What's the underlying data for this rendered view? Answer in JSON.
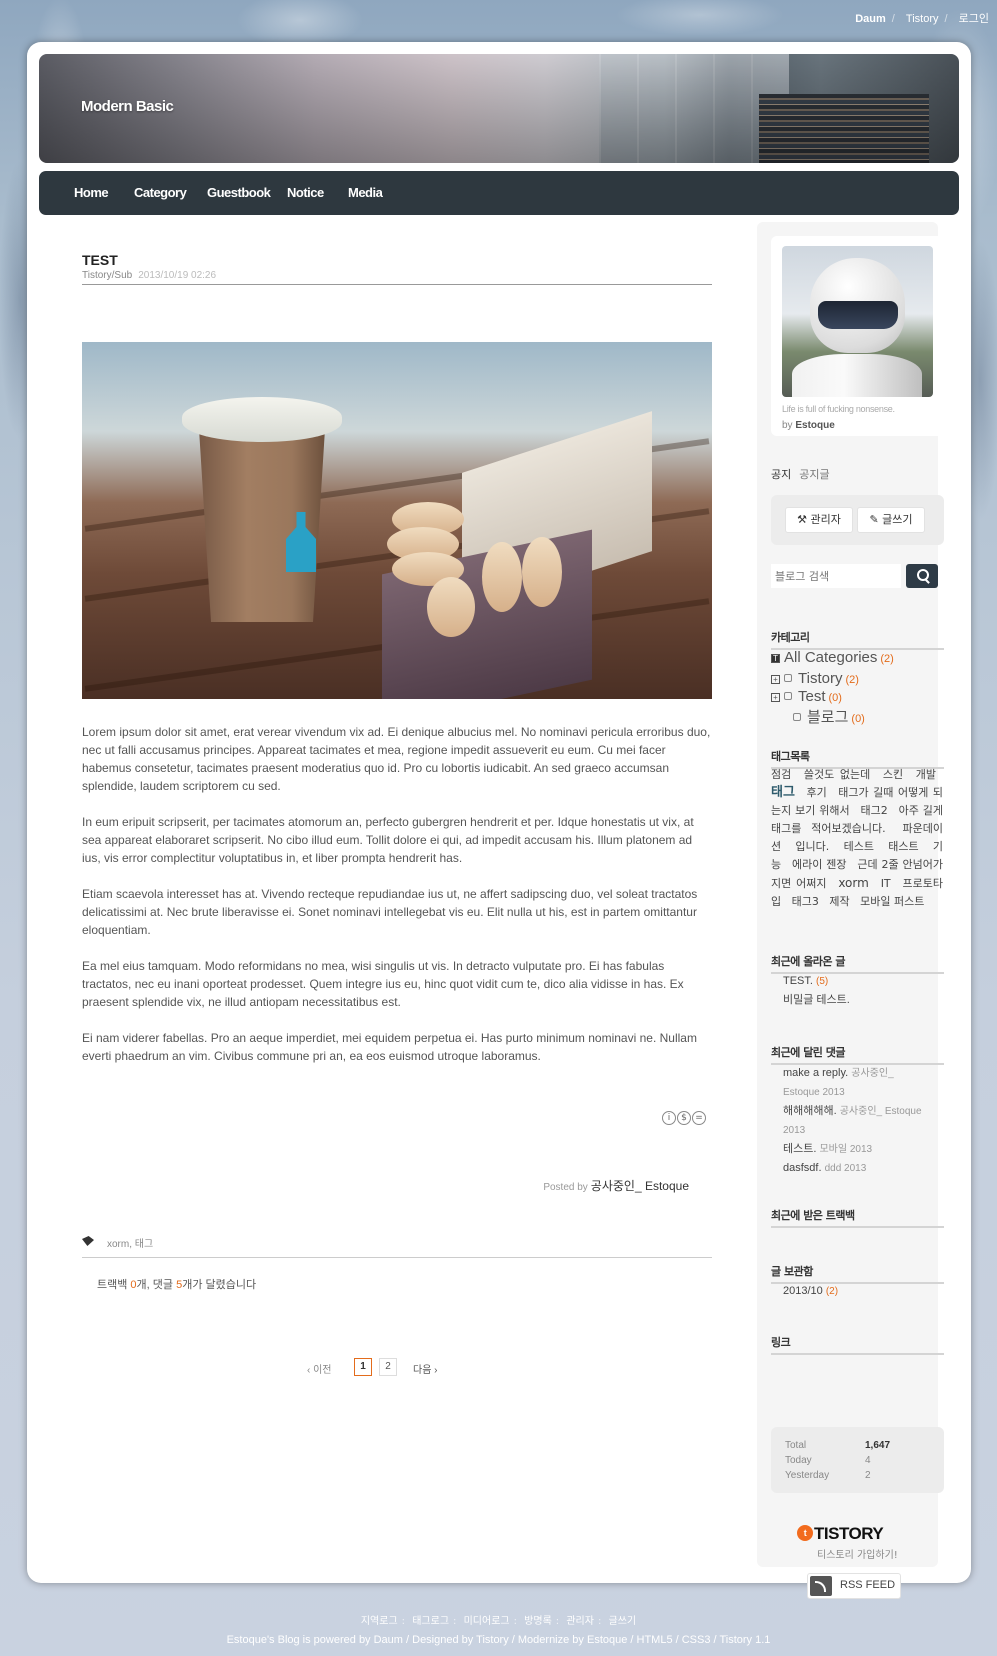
{
  "topnav": {
    "daum": "Daum",
    "tistory": "Tistory",
    "login": "로그인"
  },
  "blog": {
    "title": "Modern Basic"
  },
  "menu": [
    "Home",
    "Category",
    "Guestbook",
    "Notice",
    "Media"
  ],
  "post": {
    "title": "TEST",
    "category": "Tistory/Sub",
    "date": "2013/10/19 02:26",
    "paragraphs": [
      "Lorem ipsum dolor sit amet, erat verear vivendum vix ad. Ei denique albucius mel. No nominavi pericula erroribus duo, nec ut falli accusamus principes. Appareat tacimates et mea, regione impedit assueverit eu eum. Cu mei facer habemus consetetur, tacimates praesent moderatius quo id. Pro cu lobortis iudicabit. An sed graeco accumsan splendide, laudem scriptorem cu sed.",
      "In eum eripuit scripserit, per tacimates atomorum an, perfecto gubergren hendrerit et per. Idque honestatis ut vix, at sea appareat elaboraret scripserit. No cibo illud eum. Tollit dolore ei qui, ad impedit accusam his. Illum platonem ad ius, vis error complectitur voluptatibus in, et liber prompta hendrerit has.",
      "Etiam scaevola interesset has at. Vivendo recteque repudiandae ius ut, ne affert sadipscing duo, vel soleat tractatos delicatissimi at. Nec brute liberavisse ei. Sonet nominavi intellegebat vis eu. Elit nulla ut his, est in partem omittantur eloquentiam.",
      "Ea mel eius tamquam. Modo reformidans no mea, wisi singulis ut vis. In detracto vulputate pro. Ei has fabulas tractatos, nec eu inani oporteat prodesset. Quem integre ius eu, hinc quot vidit cum te, dico alia vidisse in has. Ex praesent splendide vix, ne illud antiopam necessitatibus est.",
      "Ei nam viderer fabellas. Pro an aeque imperdiet, mei equidem perpetua ei. Has purto minimum nominavi ne. Nullam everti phaedrum an vim. Civibus commune pri an, ea eos euismod utroque laboramus."
    ],
    "posted_by_label": "Posted by",
    "author": "공사중인_ Estoque",
    "tags": "xorm, 태그",
    "trackback_prefix": "트랙백 ",
    "trackback_count": "0",
    "trackback_mid": "개, 댓글 ",
    "comment_count": "5",
    "trackback_suffix": "개가 달렸습니다"
  },
  "paging": {
    "prev": "‹ 이전",
    "pages": [
      "1",
      "2"
    ],
    "current": "1",
    "next": "다음 ›"
  },
  "sidebar": {
    "profile": {
      "quote": "Life is full of fucking nonsense.",
      "by_label": "by",
      "name": "Estoque"
    },
    "notice": {
      "label": "공지",
      "link": "공지글"
    },
    "admin_button": "관리자",
    "write_button": "글쓰기",
    "search_placeholder": "블로그 검색",
    "category_title": "카테고리",
    "categories": [
      {
        "name": "All Categories",
        "count": "(2)"
      },
      {
        "name": "Tistory",
        "count": "(2)"
      },
      {
        "name": "Test",
        "count": "(0)"
      },
      {
        "name": "블로그",
        "count": "(0)"
      }
    ],
    "tags_title": "태그목록",
    "tags": [
      "점검",
      "쓸것도 없는데",
      "스킨",
      "개발",
      "태그",
      "후기",
      "태그가 길때 어떻게 되는지 보기 위해서",
      "태그2",
      "아주 길게 태그를 적어보겠습니다.",
      "파운데이션",
      "입니다.",
      "테스트",
      "태스트",
      "기능",
      "에라이 젠장",
      "근데 2줄 안넘어가지면 어쩌지",
      "xorm",
      "IT",
      "프로토타입",
      "태그3",
      "제작",
      "모바일 퍼스트"
    ],
    "recent_posts_title": "최근에 올라온 글",
    "recent_posts": [
      {
        "title": "TEST.",
        "count": "(5)"
      },
      {
        "title": "비밀글 테스트.",
        "count": ""
      }
    ],
    "recent_comments_title": "최근에 달린 댓글",
    "recent_comments": [
      {
        "text": "make a reply.",
        "meta": "공사중인_ Estoque 2013"
      },
      {
        "text": "해해해해해.",
        "meta": "공사중인_ Estoque 2013"
      },
      {
        "text": "테스트.",
        "meta": "모바일 2013"
      },
      {
        "text": "dasfsdf.",
        "meta": "ddd 2013"
      }
    ],
    "recent_trackbacks_title": "최근에 받은 트랙백",
    "archive_title": "글 보관함",
    "archive": [
      {
        "month": "2013/10",
        "count": "(2)"
      }
    ],
    "links_title": "링크",
    "counter": {
      "total_label": "Total",
      "total": "1,647",
      "today_label": "Today",
      "today": "4",
      "yesterday_label": "Yesterday",
      "yesterday": "2"
    },
    "tistory_logo": "TISTORY",
    "tistory_join": "티스토리 가입하기!",
    "rss_label": "RSS FEED"
  },
  "footer": {
    "links": [
      "지역로그",
      "태그로그",
      "미디어로그",
      "방명록",
      "관리자",
      "글쓰기"
    ],
    "credit": "Estoque's Blog is powered by Daum / Designed by Tistory / Modernize by Estoque / HTML5 / CSS3 / Tistory 1.1"
  },
  "colors": {
    "accent": "#e36c1c",
    "menubar": "#2e383f",
    "search_button": "#2e3b46"
  },
  "icons": [
    "search-icon",
    "wrench-icon",
    "pencil-icon",
    "tag-icon",
    "rss-icon",
    "creative-commons-icon"
  ]
}
